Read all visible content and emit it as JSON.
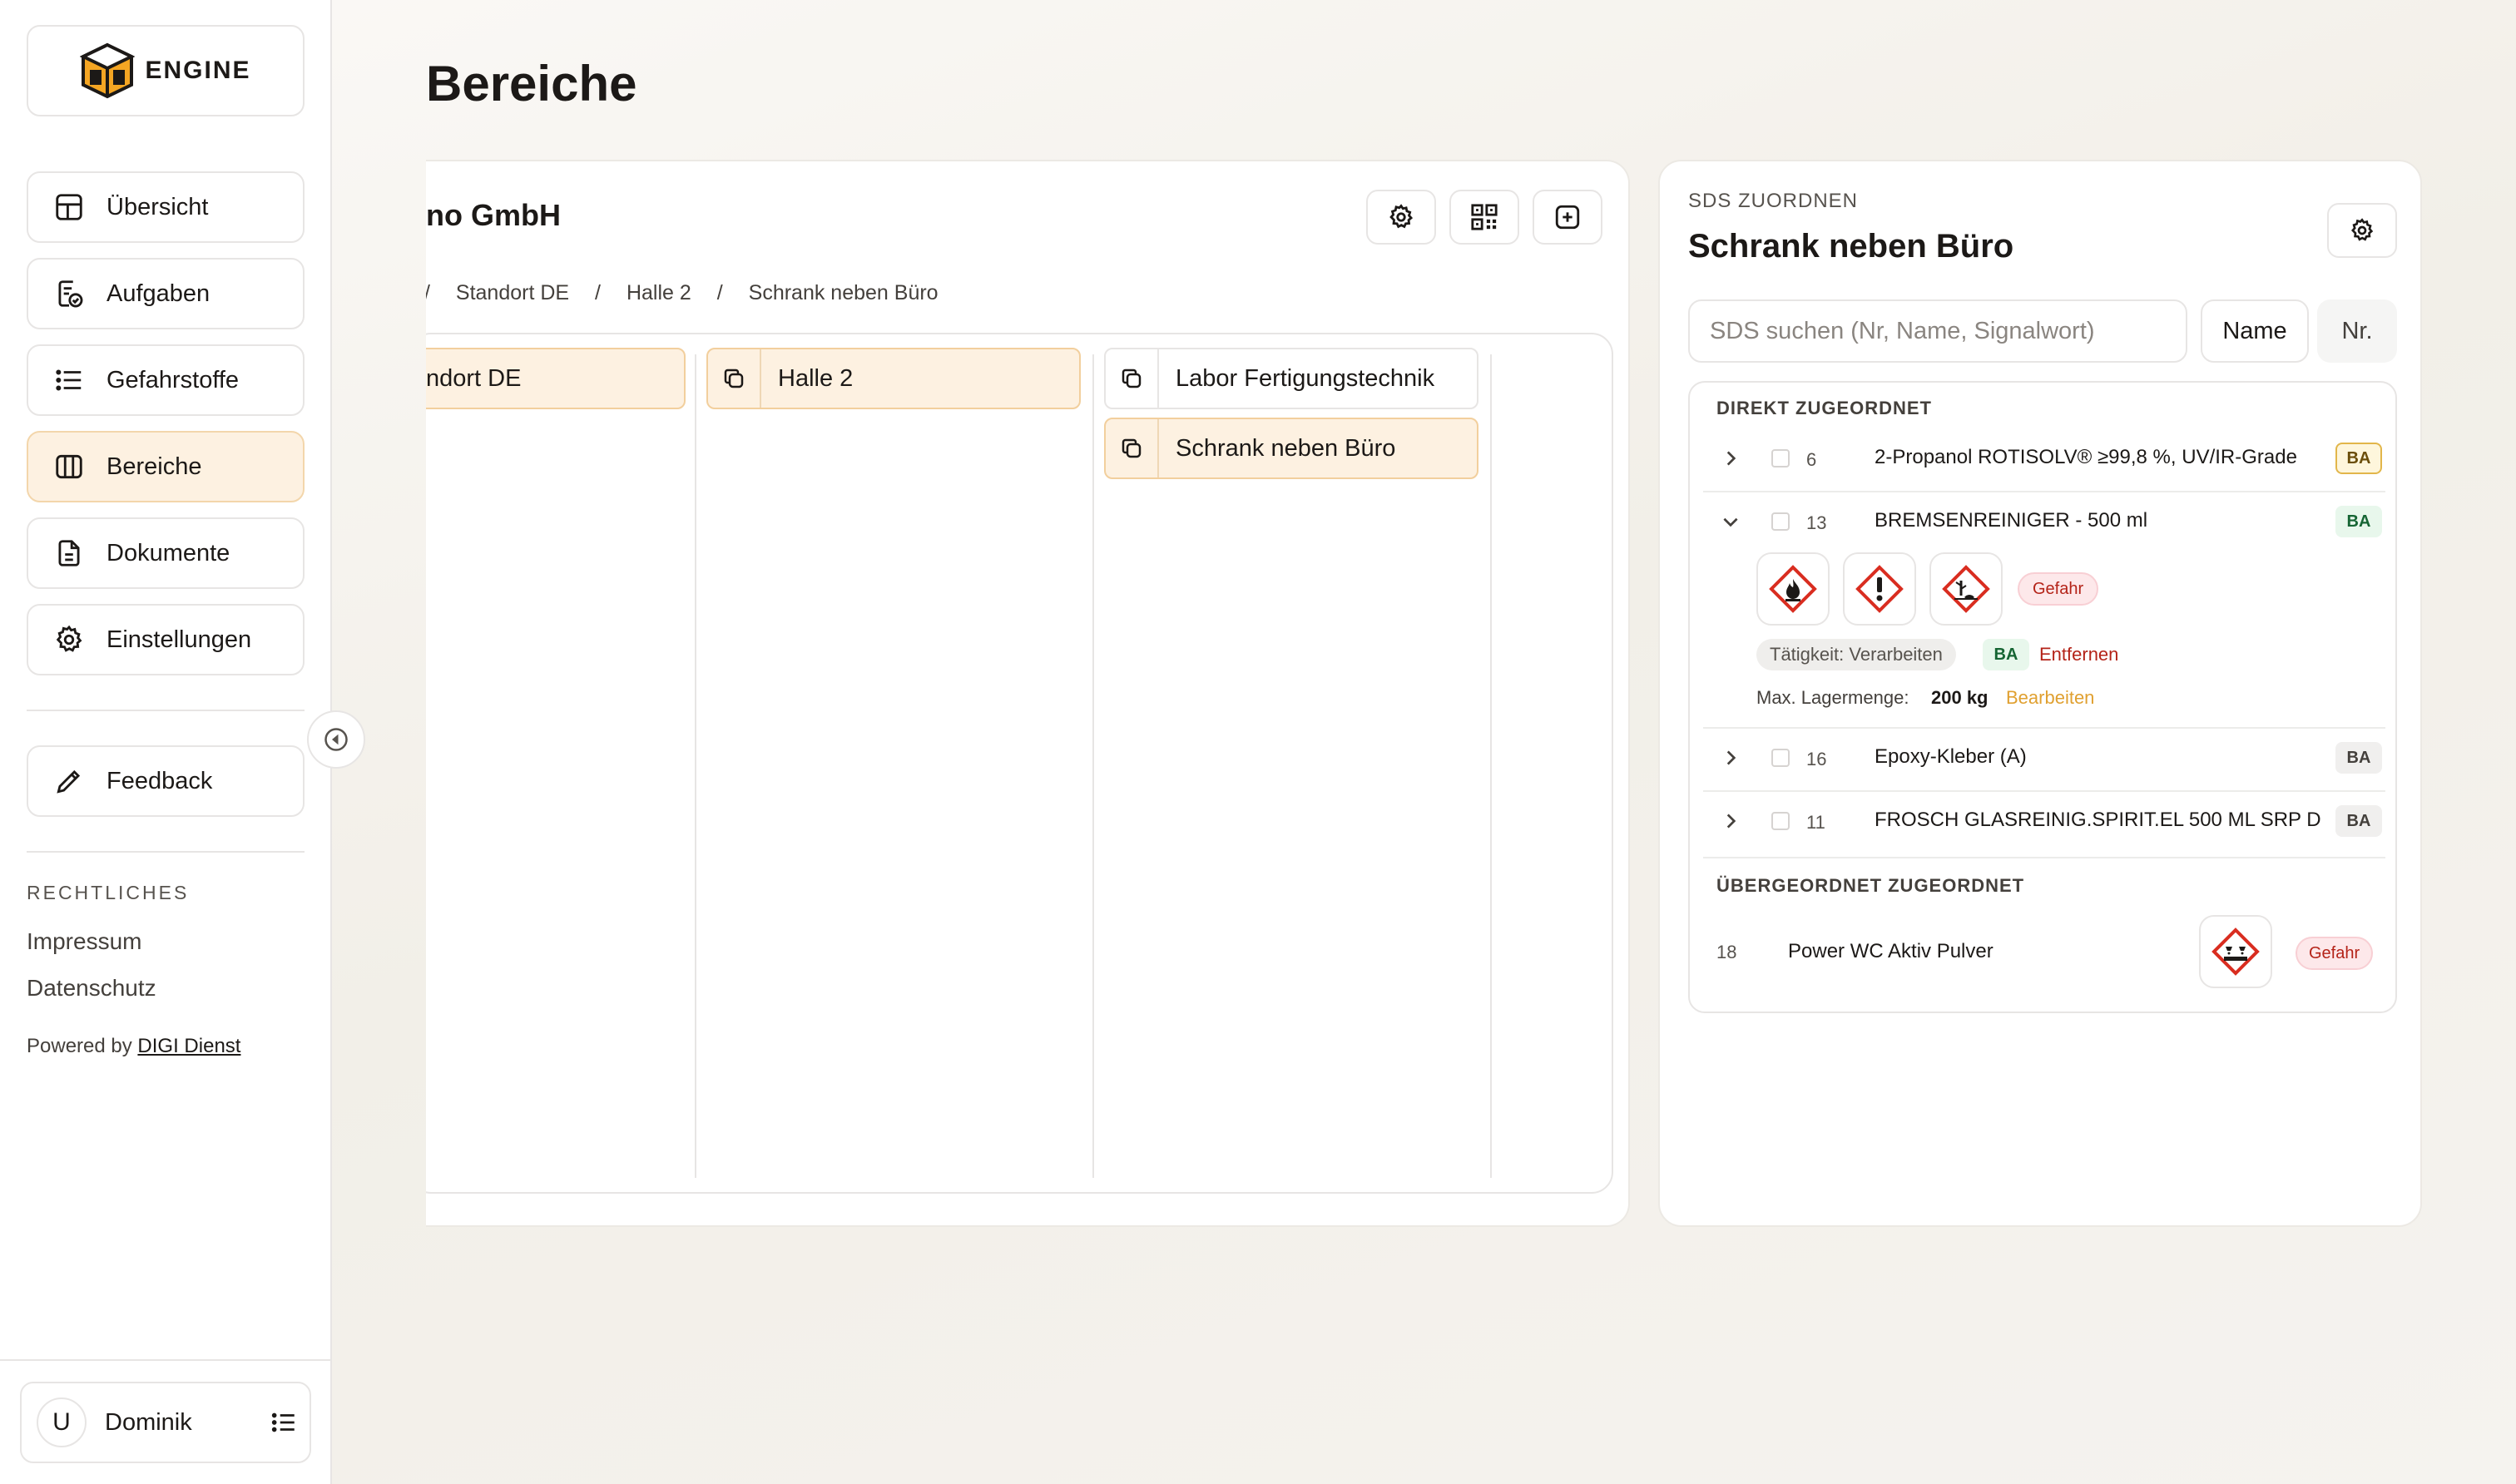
{
  "brand": {
    "name": "ENGINE"
  },
  "nav": [
    {
      "label": "Übersicht",
      "icon": "layout-dashboard-icon"
    },
    {
      "label": "Aufgaben",
      "icon": "clipboard-check-icon"
    },
    {
      "label": "Gefahrstoffe",
      "icon": "list-icon"
    },
    {
      "label": "Bereiche",
      "icon": "columns-icon",
      "active": true
    },
    {
      "label": "Dokumente",
      "icon": "document-icon"
    },
    {
      "label": "Einstellungen",
      "icon": "gear-icon"
    }
  ],
  "feedback": {
    "label": "Feedback",
    "icon": "pencil-icon"
  },
  "legal": {
    "heading": "RECHTLICHES",
    "links": [
      "Impressum",
      "Datenschutz"
    ],
    "powered_prefix": "Powered by",
    "powered_link": "DIGI Dienst"
  },
  "user": {
    "initial": "U",
    "name": "Dominik"
  },
  "page": {
    "title": "Bereiche"
  },
  "area": {
    "org_title": "no GmbH",
    "breadcrumb": [
      "/",
      "Standort DE",
      "/",
      "Halle 2",
      "/",
      "Schrank neben Büro"
    ],
    "columns": [
      {
        "items": [
          {
            "label": "ndort DE",
            "selected": true
          }
        ]
      },
      {
        "items": [
          {
            "label": "Halle 2",
            "selected": true
          }
        ]
      },
      {
        "items": [
          {
            "label": "Labor Fertigungstechnik",
            "selected": false
          },
          {
            "label": "Schrank neben Büro",
            "selected": true
          }
        ]
      }
    ]
  },
  "sds": {
    "subtitle": "SDS ZUORDNEN",
    "title": "Schrank neben Büro",
    "search_placeholder": "SDS suchen (Nr, Name, Signalwort)",
    "sort_name": "Name",
    "sort_nr": "Nr.",
    "direct_heading": "DIREKT ZUGEORDNET",
    "rows": [
      {
        "nr": "6",
        "name": "2-Propanol ROTISOLV® ≥99,8 %, UV/IR-Grade",
        "badge": "BA",
        "expanded": false
      },
      {
        "nr": "13",
        "name": "BREMSENREINIGER - 500 ml",
        "badge": "BA",
        "expanded": true
      },
      {
        "nr": "16",
        "name": "Epoxy-Kleber (A)",
        "badge": "BA",
        "expanded": false
      },
      {
        "nr": "11",
        "name": "FROSCH GLASREINIG.SPIRIT.EL 500 ML SRP D",
        "badge": "BA",
        "expanded": false
      }
    ],
    "expanded_detail": {
      "hazards": [
        "flame-pictogram-icon",
        "exclamation-pictogram-icon",
        "environment-pictogram-icon"
      ],
      "signal": "Gefahr",
      "activity": "Tätigkeit: Verarbeiten",
      "activity_badge": "BA",
      "remove": "Entfernen",
      "max_label": "Max. Lagermenge:",
      "max_value": "200 kg",
      "edit": "Bearbeiten"
    },
    "parent_heading": "ÜBERGEORDNET ZUGEORDNET",
    "parent_rows": [
      {
        "nr": "18",
        "name": "Power WC Aktiv Pulver",
        "hazard": "corrosive-pictogram-icon",
        "signal": "Gefahr"
      }
    ]
  },
  "colors": {
    "accent_bg": "#fdf1e1",
    "accent_border": "#f2cf9d",
    "danger": "#b42318",
    "edit": "#e0a030"
  }
}
